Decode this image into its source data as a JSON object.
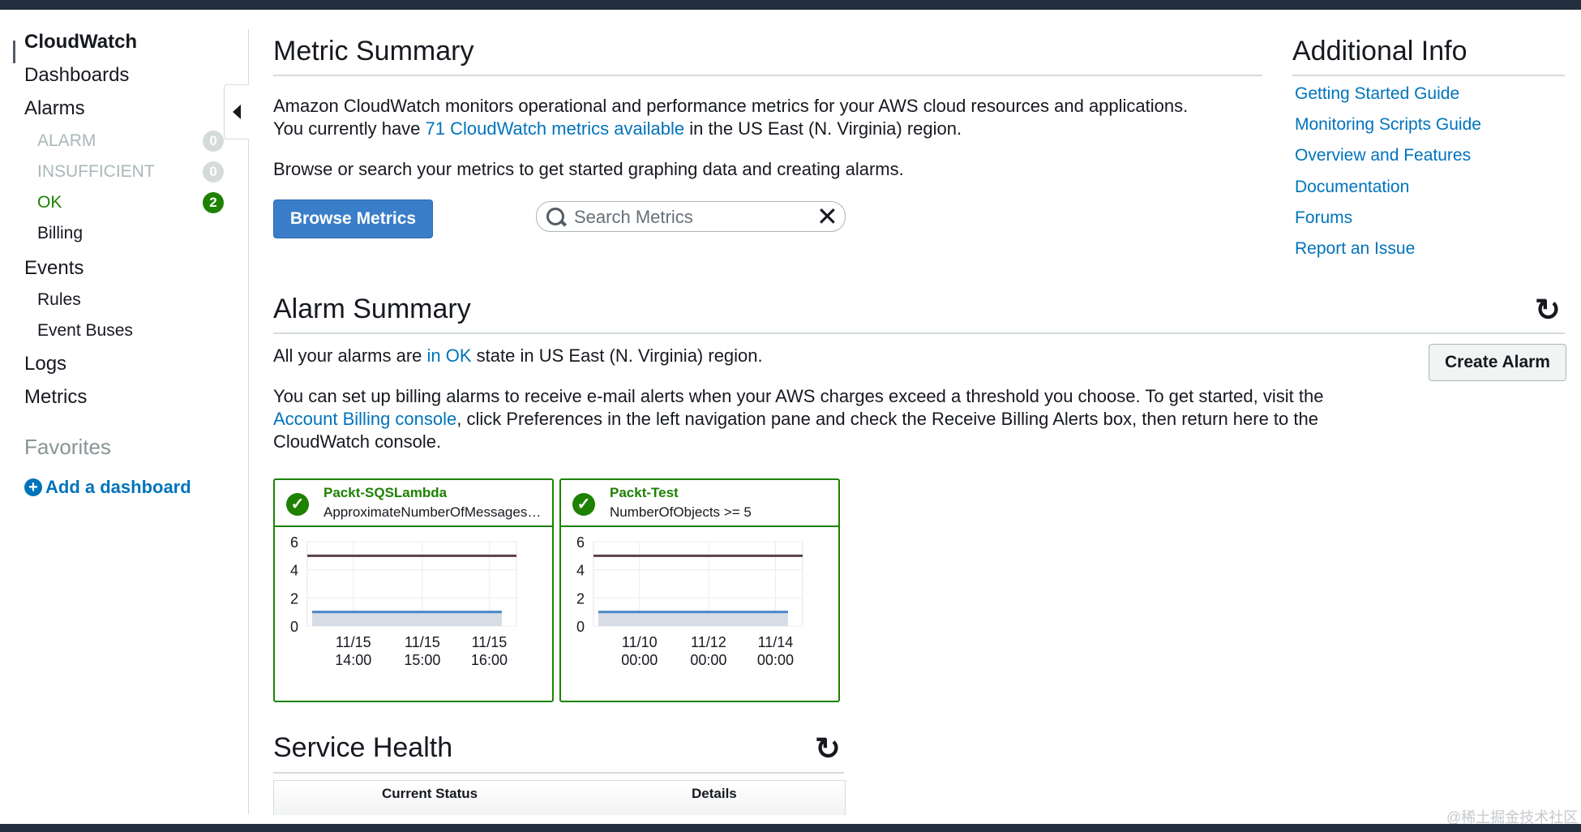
{
  "sidebar": {
    "title": "CloudWatch",
    "items": [
      {
        "label": "Dashboards"
      },
      {
        "label": "Alarms"
      },
      {
        "label": "ALARM",
        "count": "0"
      },
      {
        "label": "INSUFFICIENT",
        "count": "0"
      },
      {
        "label": "OK",
        "count": "2"
      },
      {
        "label": "Billing"
      },
      {
        "label": "Events"
      },
      {
        "label": "Rules"
      },
      {
        "label": "Event Buses"
      },
      {
        "label": "Logs"
      },
      {
        "label": "Metrics"
      }
    ],
    "favorites_label": "Favorites",
    "add_dashboard": "Add a dashboard",
    "add_icon": "plus-circle-icon"
  },
  "metric_summary": {
    "title": "Metric Summary",
    "line1": "Amazon CloudWatch monitors operational and performance metrics for your AWS cloud resources and applications.",
    "line2_prefix": "You currently have",
    "line2_link": "71 CloudWatch metrics available",
    "line2_suffix": "in the US East (N. Virginia) region.",
    "browse_text": "Browse or search your metrics to get started graphing data and creating alarms.",
    "browse_button": "Browse Metrics",
    "search_placeholder": "Search Metrics"
  },
  "additional_info": {
    "title": "Additional Info",
    "links": [
      "Getting Started Guide",
      "Monitoring Scripts Guide",
      "Overview and Features",
      "Documentation",
      "Forums",
      "Report an Issue"
    ]
  },
  "alarm_summary": {
    "title": "Alarm Summary",
    "status_prefix": "All your alarms are",
    "status_link": "in OK",
    "status_suffix": "state in US East (N. Virginia) region.",
    "billing_line1": "You can set up billing alarms to receive e-mail alerts when your AWS charges exceed a threshold you choose. To get started, visit the",
    "billing_link": "Account Billing console",
    "billing_line2_rest": ", click Preferences in the left navigation pane and check the Receive Billing Alerts box, then return here to the",
    "billing_line3": "CloudWatch console.",
    "create_button": "Create Alarm",
    "cards": [
      {
        "name": "Packt-SQSLambda",
        "metric": "ApproximateNumberOfMessagesVi...",
        "y_ticks": [
          "6",
          "4",
          "2",
          "0"
        ],
        "x_ticks": [
          [
            "11/15",
            "14:00"
          ],
          [
            "11/15",
            "15:00"
          ],
          [
            "11/15",
            "16:00"
          ]
        ],
        "threshold": 5,
        "value": 1
      },
      {
        "name": "Packt-Test",
        "metric": "NumberOfObjects >= 5",
        "y_ticks": [
          "6",
          "4",
          "2",
          "0"
        ],
        "x_ticks": [
          [
            "11/10",
            "00:00"
          ],
          [
            "11/12",
            "00:00"
          ],
          [
            "11/14",
            "00:00"
          ]
        ],
        "threshold": 5,
        "value": 1
      }
    ]
  },
  "service_health": {
    "title": "Service Health",
    "columns": [
      "Current Status",
      "Details"
    ]
  },
  "watermark": "@稀土掘金技术社区",
  "colors": {
    "link": "#0073bb",
    "ok_green": "#1d8102",
    "primary_button": "#3a7ec9"
  }
}
